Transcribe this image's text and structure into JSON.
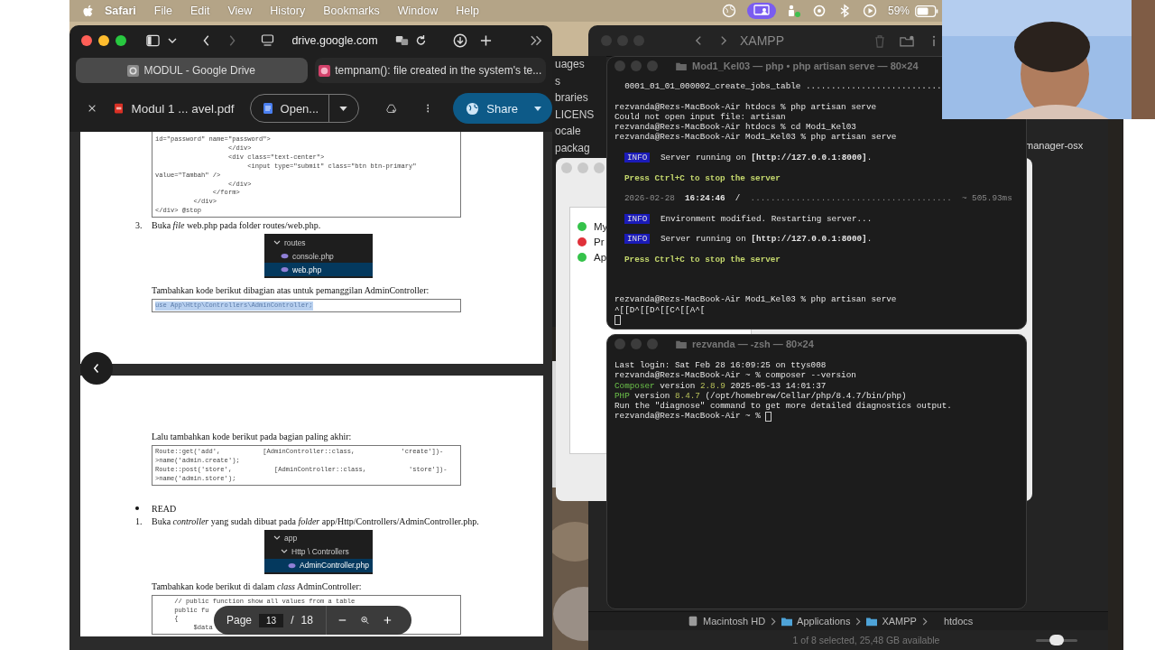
{
  "menu_bar": {
    "app": "Safari",
    "menus": [
      "File",
      "Edit",
      "View",
      "History",
      "Bookmarks",
      "Window",
      "Help"
    ],
    "battery": "59%"
  },
  "browser": {
    "address": "drive.google.com",
    "tabs": [
      {
        "label": "MODUL - Google Drive",
        "selected": true
      },
      {
        "label": "tempnam(): file created in the system's te...",
        "selected": false
      }
    ],
    "viewer": {
      "file_name": "Modul 1 ... avel.pdf",
      "open_button": "Open...",
      "share_button": "Share",
      "pages": [
        {
          "blocks": [
            {
              "kind": "code",
              "selected": false,
              "lines": [
                "id=\"password\" name=\"password\">",
                "                   </div>",
                "                   <div class=\"text-center\">",
                "                        <input type=\"submit\" class=\"btn btn-primary\"",
                "value=\"Tambah\" />",
                "                   </div>",
                "               </form>",
                "          </div>",
                "</div> @stop"
              ]
            },
            {
              "kind": "step",
              "number": "3.",
              "text": "Buka *file* web.php pada folder routes/web.php."
            },
            {
              "kind": "tree",
              "tree": [
                {
                  "name": "routes",
                  "expanded": true,
                  "children": [
                    {
                      "name": "console.php",
                      "selected": false
                    },
                    {
                      "name": "web.php",
                      "selected": true
                    }
                  ]
                }
              ]
            },
            {
              "kind": "paragraph",
              "text": "Tambahkan kode berikut dibagian atas untuk pemanggilan AdminController:"
            },
            {
              "kind": "code",
              "selected": true,
              "lines": [
                "use App\\Http\\Controllers\\AdminController;"
              ]
            }
          ]
        },
        {
          "blocks": [
            {
              "kind": "paragraph",
              "text": "Lalu tambahkan kode berikut pada bagian paling akhir:"
            },
            {
              "kind": "code",
              "selected": false,
              "lines": [
                "Route::get('add',           [AdminController::class,            'create'])-",
                ">name('admin.create');",
                "Route::post('store',           [AdminController::class,           'store'])-",
                ">name('admin.store');"
              ]
            },
            {
              "kind": "bullet",
              "text": "READ"
            },
            {
              "kind": "step",
              "number": "1.",
              "text": "Buka *controller* yang sudah dibuat pada *folder* app/Http/Controllers/AdminController.php."
            },
            {
              "kind": "tree",
              "tree": [
                {
                  "name": "app",
                  "expanded": true,
                  "children": [
                    {
                      "name": "Http \\ Controllers",
                      "expanded": true,
                      "children": [
                        {
                          "name": "AdminController.php",
                          "selected": true
                        }
                      ]
                    }
                  ]
                }
              ]
            },
            {
              "kind": "paragraph",
              "text": "Tambahkan kode berikut di dalam *class* AdminController:"
            },
            {
              "kind": "code",
              "selected": false,
              "lines": [
                "     // public function show all values from a table",
                "     public fu",
                "     {",
                "          $data"
              ]
            }
          ]
        }
      ],
      "page_control": {
        "label": "Page",
        "current": "13",
        "separator": "/",
        "total": "18"
      }
    }
  },
  "finder": {
    "title": "XAMPP",
    "side_items": [
      "uages",
      "s",
      "braries",
      "LICENS",
      "ocale",
      "packag"
    ],
    "item": "manager-osx",
    "path": [
      {
        "label": "Macintosh HD",
        "kind": "disk"
      },
      {
        "label": "Applications",
        "kind": "folder"
      },
      {
        "label": "XAMPP",
        "kind": "folder"
      },
      {
        "label": "htdocs",
        "kind": "plain"
      }
    ],
    "status": "1 of 8 selected, 25,48 GB available",
    "icon_size": {
      "level": 0.5
    }
  },
  "xampp_manager": {
    "services": [
      {
        "label": "My",
        "color": "#35c24a"
      },
      {
        "label": "Pr",
        "color": "#e0313a"
      },
      {
        "label": "Ap",
        "color": "#35c24a"
      }
    ]
  },
  "terminals": [
    {
      "title": "Mod1_Kel03 — php • php artisan serve — 80×24",
      "lines": [
        {
          "kind": "plain",
          "text": "  0001_01_01_000002_create_jobs_table ..........................."
        },
        {
          "kind": "plain",
          "text": "rezvanda@Rezs-MacBook-Air htdocs % php artisan serve"
        },
        {
          "kind": "plain",
          "text": "Could not open input file: artisan"
        },
        {
          "kind": "plain",
          "text": "rezvanda@Rezs-MacBook-Air htdocs % cd Mod1_Kel03"
        },
        {
          "kind": "plain",
          "text": "rezvanda@Rezs-MacBook-Air Mod1_Kel03 % php artisan serve"
        },
        {
          "kind": "info",
          "badge": "INFO",
          "text": "Server running on **[http://127.0.0.1:8000]**."
        },
        {
          "kind": "hint",
          "text": "Press Ctrl+C to stop the server"
        },
        {
          "kind": "timing",
          "date": "2026-02-28",
          "time": "16:24:46",
          "path": "/",
          "dots": "........................................",
          "duration": "~ 505.93ms"
        },
        {
          "kind": "info",
          "badge": "INFO",
          "text": "Environment modified. Restarting server..."
        },
        {
          "kind": "info",
          "badge": "INFO",
          "text": "Server running on **[http://127.0.0.1:8000]**."
        },
        {
          "kind": "hint",
          "text": "Press Ctrl+C to stop the server"
        },
        {
          "kind": "plain",
          "text": "rezvanda@Rezs-MacBook-Air Mod1_Kel03 % php artisan serve"
        },
        {
          "kind": "plain",
          "text": "^[[D^[[D^[[C^[[A^["
        },
        {
          "kind": "cursor"
        }
      ]
    },
    {
      "title": "rezvanda — -zsh — 80×24",
      "lines": [
        {
          "kind": "plain",
          "text": "Last login: Sat Feb 28 16:09:25 on ttys008"
        },
        {
          "kind": "plain",
          "text": "rezvanda@Rezs-MacBook-Air ~ % composer --version"
        },
        {
          "kind": "version",
          "name": "Composer",
          "word": "version",
          "number": "2.8.9",
          "rest": "2025-05-13 14:01:37"
        },
        {
          "kind": "version",
          "name": "PHP",
          "word": "version",
          "number": "8.4.7",
          "rest": "(/opt/homebrew/Cellar/php/8.4.7/bin/php)"
        },
        {
          "kind": "plain",
          "text": "Run the \"diagnose\" command to get more detailed diagnostics output."
        },
        {
          "kind": "prompt",
          "text": "rezvanda@Rezs-MacBook-Air ~ %"
        }
      ]
    }
  ]
}
